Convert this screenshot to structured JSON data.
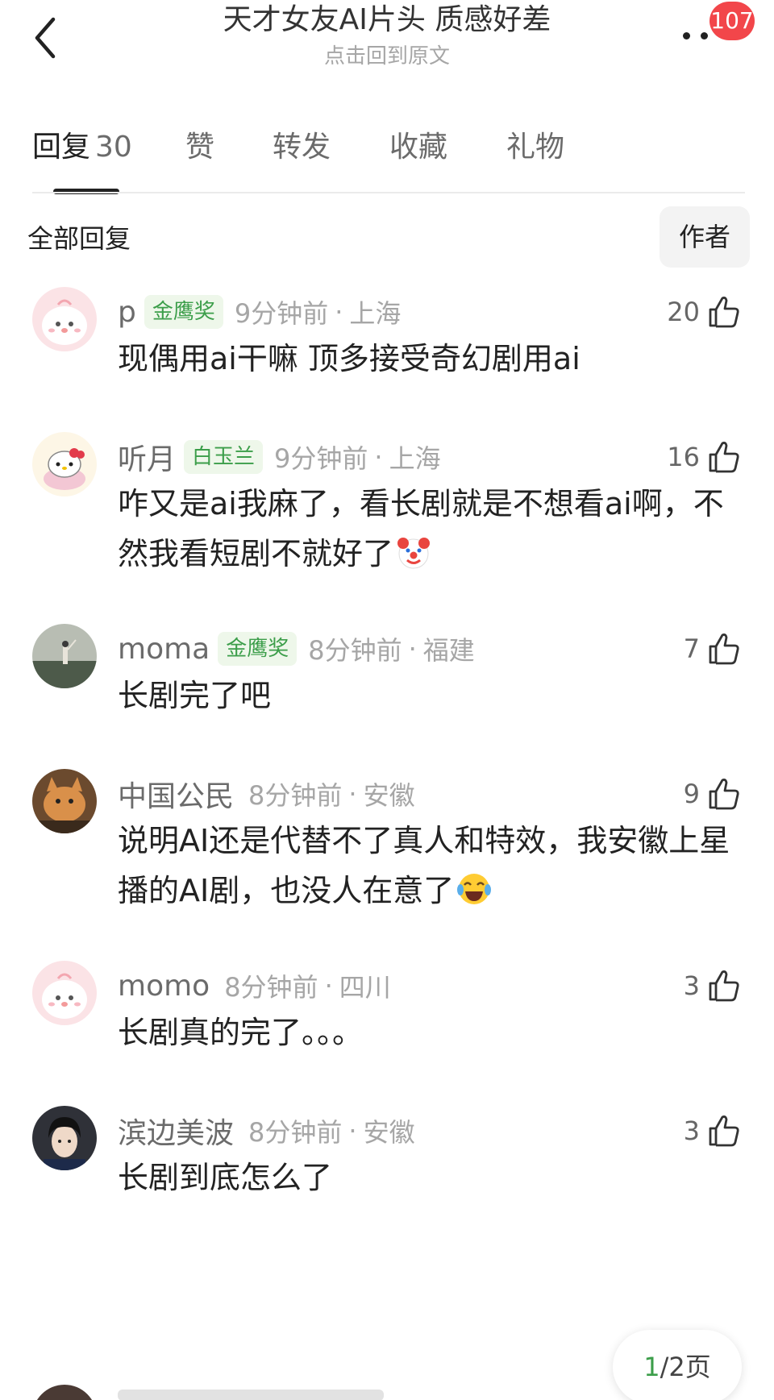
{
  "header": {
    "title": "天才女友AI片头 质感好差",
    "subtitle": "点击回到原文",
    "badge": "107"
  },
  "tabs": [
    {
      "label": "回复",
      "count": "30"
    },
    {
      "label": "赞"
    },
    {
      "label": "转发"
    },
    {
      "label": "收藏"
    },
    {
      "label": "礼物"
    }
  ],
  "filter": {
    "all_label": "全部回复",
    "author_label": "作者"
  },
  "comments": [
    {
      "user": "p",
      "award": "金鹰奖",
      "time": "9分钟前",
      "sep": "·",
      "location": "上海",
      "likes": "20",
      "text": "现偶用ai干嘛 顶多接受奇幻剧用ai",
      "avatar": "pink-chick-icon"
    },
    {
      "user": "听月",
      "award": "白玉兰",
      "time": "9分钟前",
      "sep": "·",
      "location": "上海",
      "likes": "16",
      "text": "咋又是ai我麻了，看长剧就是不想看ai啊，不然我看短剧不就好了",
      "emoji": "clown-face-emoji",
      "avatar": "hello-kitty-icon"
    },
    {
      "user": "moma",
      "award": "金鹰奖",
      "time": "8分钟前",
      "sep": "·",
      "location": "福建",
      "likes": "7",
      "text": "长剧完了吧",
      "avatar": "person-landscape-photo"
    },
    {
      "user": "中国公民",
      "time": "8分钟前",
      "sep": "·",
      "location": "安徽",
      "likes": "9",
      "text": "说明AI还是代替不了真人和特效，我安徽上星播的AI剧，也没人在意了",
      "emoji": "tears-of-joy-emoji",
      "avatar": "cat-photo"
    },
    {
      "user": "momo",
      "time": "8分钟前",
      "sep": "·",
      "location": "四川",
      "likes": "3",
      "text": "长剧真的完了。。。",
      "avatar": "pink-chick-icon"
    },
    {
      "user": "滨边美波",
      "time": "8分钟前",
      "sep": "·",
      "location": "安徽",
      "likes": "3",
      "text": "长剧到底怎么了",
      "avatar": "girl-portrait-photo"
    }
  ],
  "pager": {
    "current": "1",
    "rest": "/2页"
  },
  "colors": {
    "badge": "#f2464a",
    "award_text": "#3c9e4a",
    "award_bg": "#eef7ea"
  }
}
